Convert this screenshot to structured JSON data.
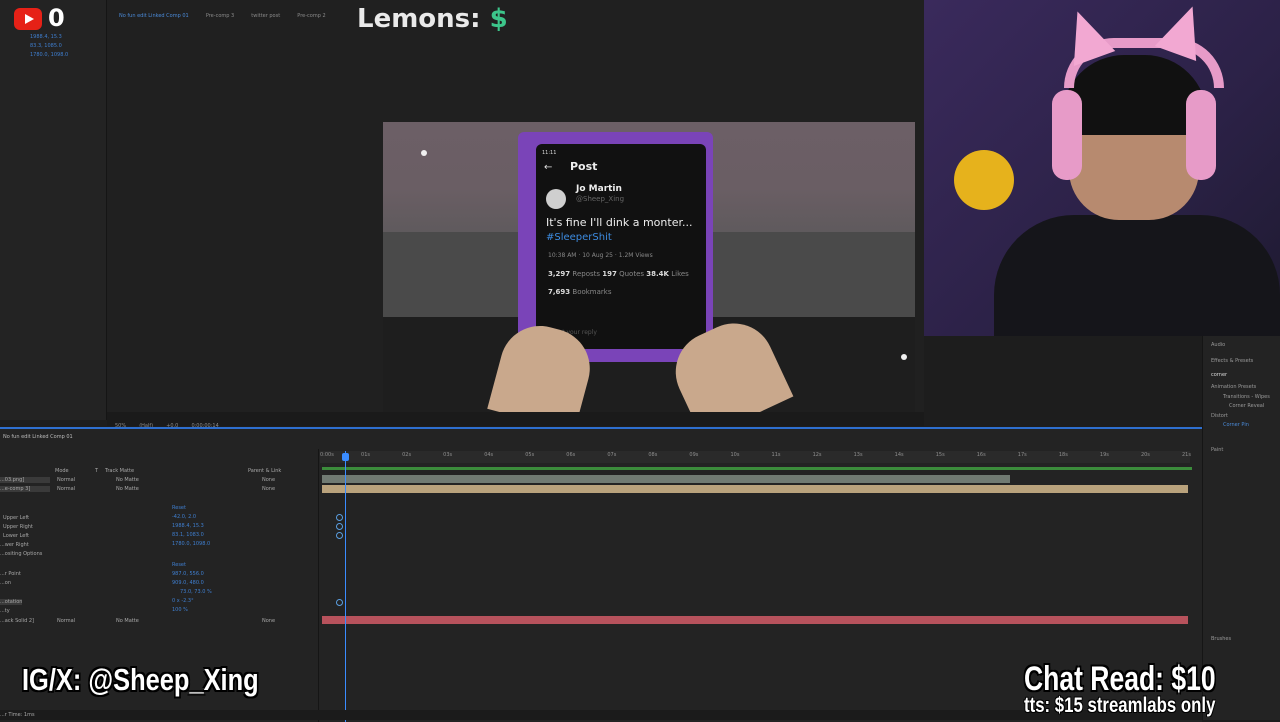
{
  "stream": {
    "youtube_count": "0",
    "lemons_label": "Lemons: ",
    "lemons_value": "$",
    "social_handle": "IG/X: @Sheep_Xing",
    "chat_read": "Chat Read: $10",
    "tts_note": "tts: $15 streamlabs only"
  },
  "project_panel": {
    "values": [
      "1988.4, 15.3",
      "83.3, 1085.0",
      "1780.0, 1098.0"
    ]
  },
  "viewer": {
    "tabs": [
      {
        "label": "No fun edit Linked Comp 01",
        "active": true
      },
      {
        "label": "Pre-comp 3",
        "active": false
      },
      {
        "label": "twitter post",
        "active": false
      },
      {
        "label": "Pre-comp 2",
        "active": false
      }
    ],
    "controls": {
      "zoom": "50%",
      "resolution": "(Half)",
      "exposure": "+0.0",
      "timecode": "0:00:00:14"
    }
  },
  "post": {
    "status_time": "11:11",
    "header": "Post",
    "author_name": "Jo Martin",
    "author_handle": "@Sheep_Xing",
    "text": "It's fine I'll dink a monter...",
    "hashtag": "#SleeperShit",
    "meta": "10:38 AM · 10 Aug 25 · 1.2M Views",
    "reposts_count": "3,297",
    "reposts_label": "Reposts",
    "quotes_count": "197",
    "quotes_label": "Quotes",
    "likes_count": "38.4K",
    "likes_label": "Likes",
    "bookmarks_count": "7,693",
    "bookmarks_label": "Bookmarks",
    "reply_placeholder": "Post your reply"
  },
  "timeline": {
    "tab_label": "No fun edit Linked Comp 01",
    "columns": {
      "mode": "Mode",
      "t": "T",
      "track_matte": "Track Matte",
      "parent": "Parent & Link"
    },
    "ruler_ticks": [
      "0:00s",
      "01s",
      "02s",
      "03s",
      "04s",
      "05s",
      "06s",
      "07s",
      "08s",
      "09s",
      "10s",
      "11s",
      "12s",
      "13s",
      "14s",
      "15s",
      "16s",
      "17s",
      "18s",
      "19s",
      "20s",
      "21s"
    ],
    "layers": [
      {
        "name": "...03.png]",
        "mode": "Normal",
        "matte": "No Matte",
        "parent": "None"
      },
      {
        "name": "...e-comp 3]",
        "mode": "Normal",
        "matte": "No Matte",
        "parent": "None"
      },
      {
        "name": "...ack Solid 2]",
        "mode": "Normal",
        "matte": "No Matte",
        "parent": "None"
      }
    ],
    "properties": [
      {
        "label": "Reset",
        "value": ""
      },
      {
        "label": "Upper Left",
        "value": "-42.0, 2.0"
      },
      {
        "label": "Upper Right",
        "value": "1988.4, 15.3"
      },
      {
        "label": "Lower Left",
        "value": "83.1, 1083.0"
      },
      {
        "label": "...wer Right",
        "value": "1780.0, 1098.0"
      },
      {
        "label": "...ositing Options",
        "value": ""
      },
      {
        "label": "Reset",
        "value": ""
      },
      {
        "label": "...r Point",
        "value": "987.0, 556.0"
      },
      {
        "label": "...on",
        "value": "909.0, 480.0"
      },
      {
        "label": "",
        "value": "73.0, 73.0 %"
      },
      {
        "label": "...otation",
        "value": "0 x -2.3°"
      },
      {
        "label": "...ty",
        "value": "100 %"
      }
    ],
    "render_time": "...r Time: 1ms"
  },
  "effects_panel": {
    "audio": "Audio",
    "effects_presets": "Effects & Presets",
    "search_value": "corner",
    "animation_presets": "Animation Presets",
    "transitions": "Transitions - Wipes",
    "corner_reveal": "Corner Reveal",
    "distort": "Distort",
    "corner_pin": "Corner Pin",
    "paint": "Paint",
    "brushes": "Brushes"
  },
  "colors": {
    "accent": "#2e6fcf",
    "value_blue": "#3f7fd0",
    "hashtag_blue": "#3d8be0",
    "dollar_green": "#3cc58a",
    "youtube_red": "#e62117"
  }
}
